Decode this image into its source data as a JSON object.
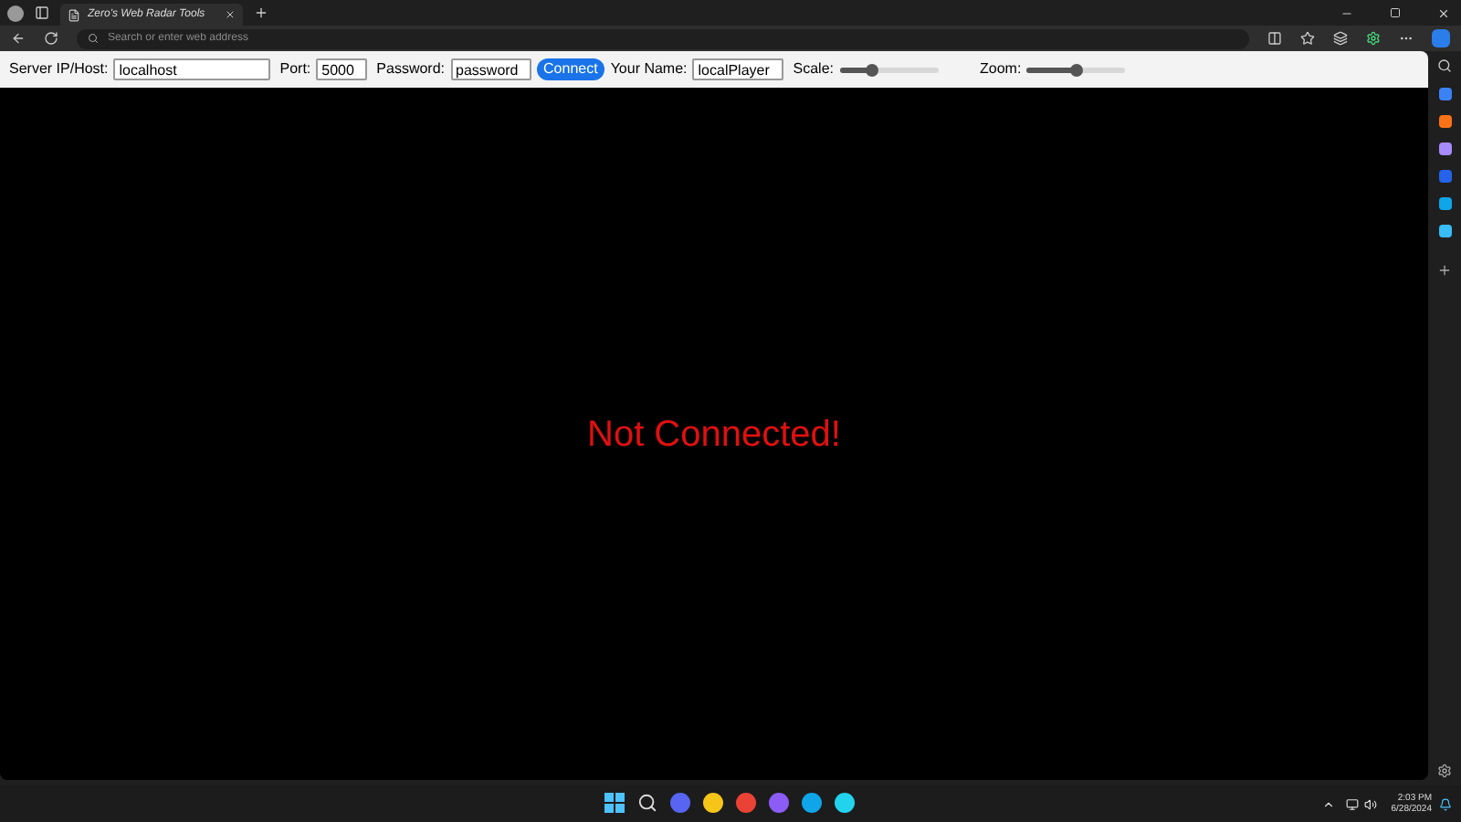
{
  "tab": {
    "title": "Zero's Web Radar Tools",
    "selected": true
  },
  "address_bar": {
    "placeholder": "Search or enter web address"
  },
  "toolbar": {
    "host_label": "Server IP/Host:",
    "host": "localhost",
    "port_label": "Port:",
    "port": "5000",
    "password_label": "Password:",
    "password": "password",
    "connect": "Connect",
    "name_label": "Your Name:",
    "name": "localPlayer",
    "scale_label": "Scale:",
    "scale": {
      "level": 0.33
    },
    "zoom_label": "Zoom:",
    "zoom": {
      "level": 0.5
    }
  },
  "status": "Not Connected!",
  "clock": {
    "time": "2:03 PM",
    "date": "6/28/2024"
  }
}
